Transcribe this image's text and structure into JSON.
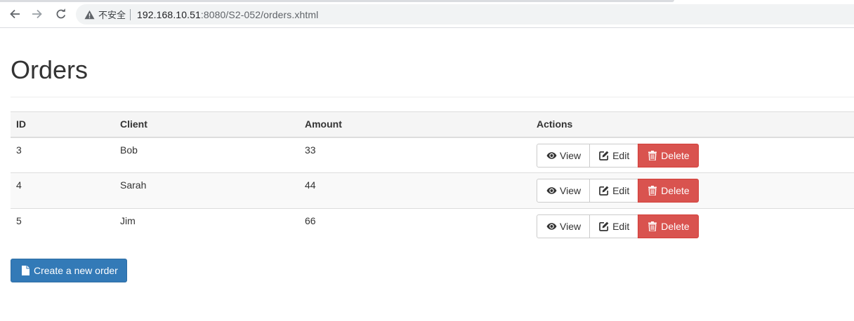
{
  "browser": {
    "security_label": "不安全",
    "url_host": "192.168.10.51",
    "url_rest": ":8080/S2-052/orders.xhtml",
    "icons": {
      "back": "arrow-left-icon",
      "forward": "arrow-right-icon",
      "reload": "reload-icon",
      "security": "warning-triangle-icon"
    }
  },
  "page": {
    "title": "Orders"
  },
  "table": {
    "headers": [
      "ID",
      "Client",
      "Amount",
      "Actions"
    ],
    "rows": [
      {
        "id": "3",
        "client": "Bob",
        "amount": "33"
      },
      {
        "id": "4",
        "client": "Sarah",
        "amount": "44"
      },
      {
        "id": "5",
        "client": "Jim",
        "amount": "66"
      }
    ],
    "actions": {
      "view_label": "View",
      "edit_label": "Edit",
      "delete_label": "Delete",
      "view_icon": "eye-icon",
      "edit_icon": "edit-icon",
      "delete_icon": "trash-icon"
    }
  },
  "create_button": {
    "label": "Create a new order",
    "icon": "file-icon"
  },
  "colors": {
    "danger": "#d9534f",
    "primary": "#337ab7"
  }
}
